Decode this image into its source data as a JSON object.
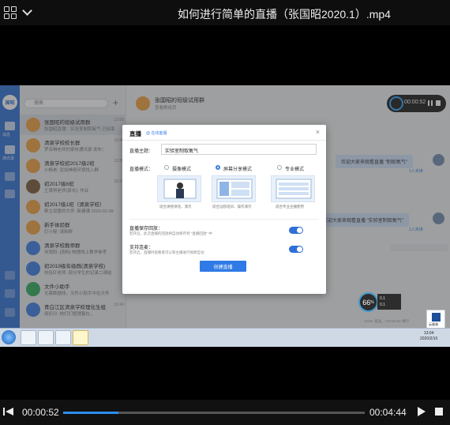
{
  "player": {
    "title": "如何进行简单的直播（张国昭2020.1）.mp4",
    "current_time": "00:00:52",
    "total_time": "00:04:44",
    "progress_fraction": 0.183,
    "colors": {
      "accent": "#2d8ff0",
      "bar": "#111111"
    }
  },
  "app": {
    "rail_logo": "国昭",
    "rail_labels": [
      "消息",
      "通讯录"
    ],
    "search_placeholder": "搜索",
    "chats": [
      {
        "name": "张国昭的班级试用群",
        "sub": "张国昭直播：实验室制取氧气 已结束",
        "time": "12:58",
        "color": "#f0a040"
      },
      {
        "name": "清泉学校校长群",
        "sub": "罗泽琳老师的家校通讯录 发布：",
        "time": "12:46",
        "color": "#f0a040"
      },
      {
        "name": "清泉学校初2017级2班",
        "sub": "小杨老: 武如神奇环境找入群",
        "time": "12:39",
        "color": "#f0a040"
      },
      {
        "name": "初2017级6班",
        "sub": "王梁明老师(家长): 作业",
        "time": "12:37",
        "color": "#7a5a3a"
      },
      {
        "name": "初2017级1班（清泉学校）",
        "sub": "群主设置的文件: 新建课 2020-02-09",
        "time": "",
        "color": "#f0a040"
      },
      {
        "name": "新手体验群",
        "sub": "钉小秘: 请新群",
        "time": "",
        "color": "#f0a040"
      },
      {
        "name": "清泉学校教师群",
        "sub": "何雨阳: [资料] 物理线上教学参考",
        "time": "",
        "color": "#3b7ee6"
      },
      {
        "name": "初2019级年级群(清泉学校)",
        "sub": "刘佳红老师: 部分学生的记录二课结",
        "time": "",
        "color": "#3b7ee6"
      },
      {
        "name": "文件小助手",
        "sub": "无需数据线，文件小助手中在文件",
        "time": "",
        "color": "#2faa5e"
      },
      {
        "name": "青白江区清泉学校理化生组",
        "sub": "用初分: 他们们管理着在，",
        "time": "12:43",
        "color": "#3b7ee6"
      }
    ],
    "chat_header": {
      "name": "张国昭的班级试用群",
      "sub": "查看群成员"
    },
    "messages": [
      {
        "text": "欢迎大家来观看直播 \"制取氧气\"",
        "note": "1人未读"
      },
      {
        "text": "欢迎大家来观看直播 \"实验室制取氧气\"",
        "note": "1人未读"
      }
    ],
    "recording_time": "00:00:52",
    "speed_value": "66",
    "speed_unit": "%",
    "speed_up": "0.1",
    "speed_down": "0.1",
    "send_hint": "Enter 发送，Ctrl+Enter 换行",
    "corner_logo_text": "云健康"
  },
  "dialog": {
    "title": "直播",
    "help": "@ 在线客服",
    "close": "×",
    "topic_label": "直播主题：",
    "topic_value": "实验室制取氧气",
    "mode_label": "直播模式：",
    "modes": [
      {
        "label": "摄像模式",
        "caption": "适合讲授讲话、演示",
        "selected": false
      },
      {
        "label": "屏幕分享模式",
        "caption": "适合远程培训、操作演示",
        "selected": true
      },
      {
        "label": "专业模式",
        "caption": "适合专业主播使用",
        "selected": false
      }
    ],
    "save_title": "直播保存回放：",
    "save_desc": "若开启，此次直播的回放将自动保存到 \"直播回放\" 中",
    "save_on": true,
    "interact_title": "支持连麦：",
    "interact_desc": "若开启，直播时观看者可以和主播进行视频互动",
    "interact_on": true,
    "create_label": "创建直播"
  },
  "taskbar": {
    "clock_time": "13:04",
    "clock_date": "2020/2/10"
  }
}
